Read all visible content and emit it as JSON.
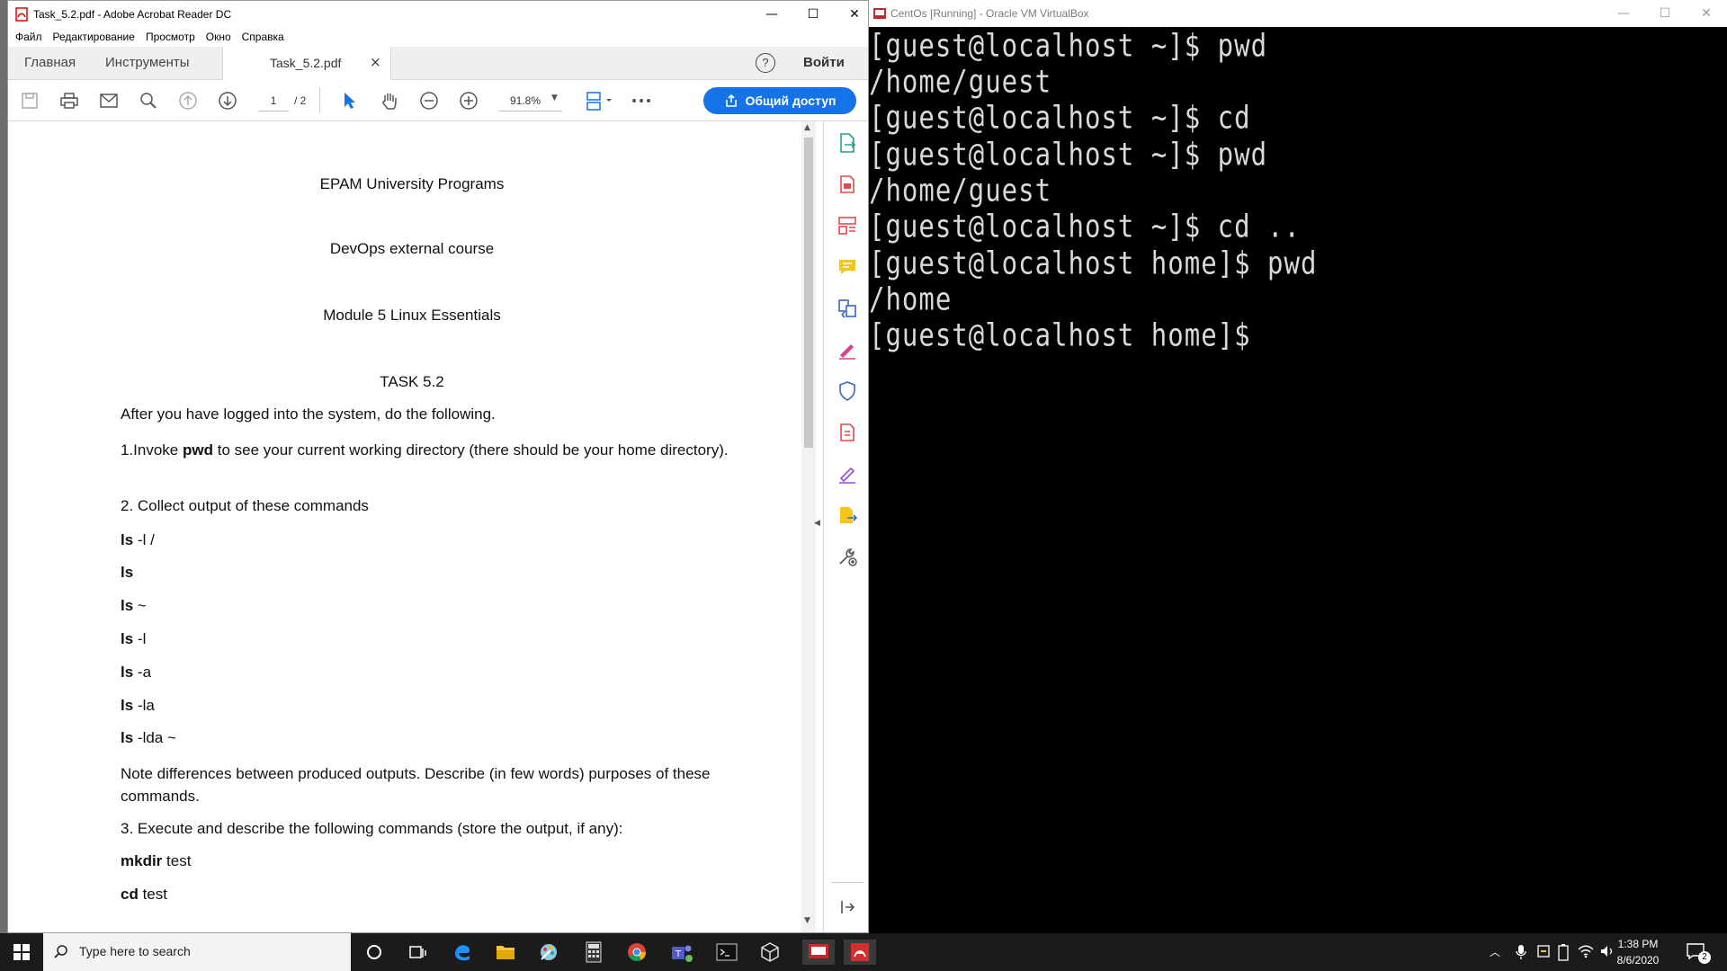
{
  "acrobat": {
    "title": "Task_5.2.pdf - Adobe Acrobat Reader DC",
    "menu": [
      "Файл",
      "Редактирование",
      "Просмотр",
      "Окно",
      "Справка"
    ],
    "tabs": {
      "home": "Главная",
      "tools": "Инструменты",
      "document": "Task_5.2.pdf",
      "close": "×"
    },
    "help": "?",
    "signin": "Войти",
    "page_current": "1",
    "page_total": "/ 2",
    "zoom": "91.8%",
    "share_label": "Общий доступ"
  },
  "document": {
    "line1": "EPAM University Programs",
    "line2": "DevOps external course",
    "line3": "Module 5 Linux Essentials",
    "task": "TASK 5.2",
    "intro": "After you have logged into the system, do the following.",
    "step1_prefix": "1.Invoke ",
    "step1_cmd": "pwd",
    "step1_rest": " to see your current working directory (there should be your home directory).",
    "step2": "2. Collect output of these commands",
    "cmds": [
      {
        "cmd": "ls",
        "arg": " -l /"
      },
      {
        "cmd": "ls",
        "arg": ""
      },
      {
        "cmd": "ls",
        "arg": " ~"
      },
      {
        "cmd": "ls",
        "arg": " -l"
      },
      {
        "cmd": "ls",
        "arg": " -a"
      },
      {
        "cmd": "ls",
        "arg": " -la"
      },
      {
        "cmd": "ls",
        "arg": " -lda ~"
      }
    ],
    "note": "Note differences between produced outputs. Describe (in few words) purposes of these commands.",
    "step3": "3. Execute and describe the following commands (store the output, if any):",
    "cmds3": [
      {
        "cmd": "mkdir",
        "arg": " test"
      },
      {
        "cmd": "cd",
        "arg": " test"
      }
    ]
  },
  "vbox": {
    "title": "CentOs [Running] - Oracle VM VirtualBox",
    "terminal_lines": [
      "[guest@localhost ~]$ pwd",
      "/home/guest",
      "[guest@localhost ~]$ cd",
      "[guest@localhost ~]$ pwd",
      "/home/guest",
      "[guest@localhost ~]$ cd ..",
      "[guest@localhost home]$ pwd",
      "/home",
      "[guest@localhost home]$ "
    ]
  },
  "taskbar": {
    "search_placeholder": "Type here to search",
    "time": "1:38 PM",
    "date": "8/6/2020",
    "notifications": "2"
  }
}
